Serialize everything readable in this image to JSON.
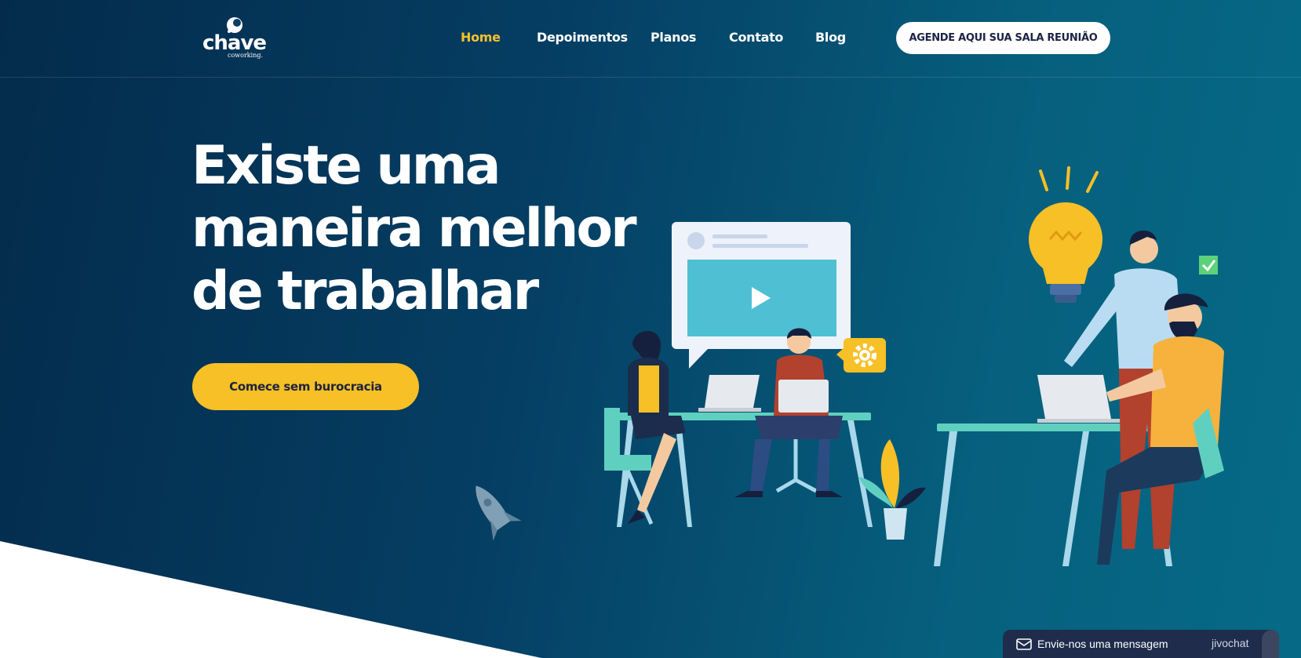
{
  "logo": {
    "word": "chave",
    "sub": "coworking."
  },
  "nav": {
    "items": [
      {
        "label": "Home",
        "active": true
      },
      {
        "label": "Depoimentos",
        "active": false
      },
      {
        "label": "Planos",
        "active": false
      },
      {
        "label": "Contato",
        "active": false
      },
      {
        "label": "Blog",
        "active": false
      }
    ],
    "cta_label": "AGENDE AQUI SUA SALA REUNIÃO"
  },
  "hero": {
    "title_lines": [
      "Existe uma",
      "maneira melhor",
      "de trabalhar"
    ],
    "cta_label": "Comece sem burocracia"
  },
  "chat": {
    "label": "Envie-nos uma mensagem",
    "brand": "jivochat"
  },
  "icons": [
    "logo-mark-icon",
    "play-icon",
    "gear-icon",
    "lightbulb-icon",
    "check-icon",
    "rocket-icon",
    "plant-icon",
    "envelope-icon"
  ],
  "colors": {
    "accent": "#f7c12a",
    "background": "#053e63",
    "button_text": "#1c2446",
    "chat_bg": "#1f2c4c"
  }
}
